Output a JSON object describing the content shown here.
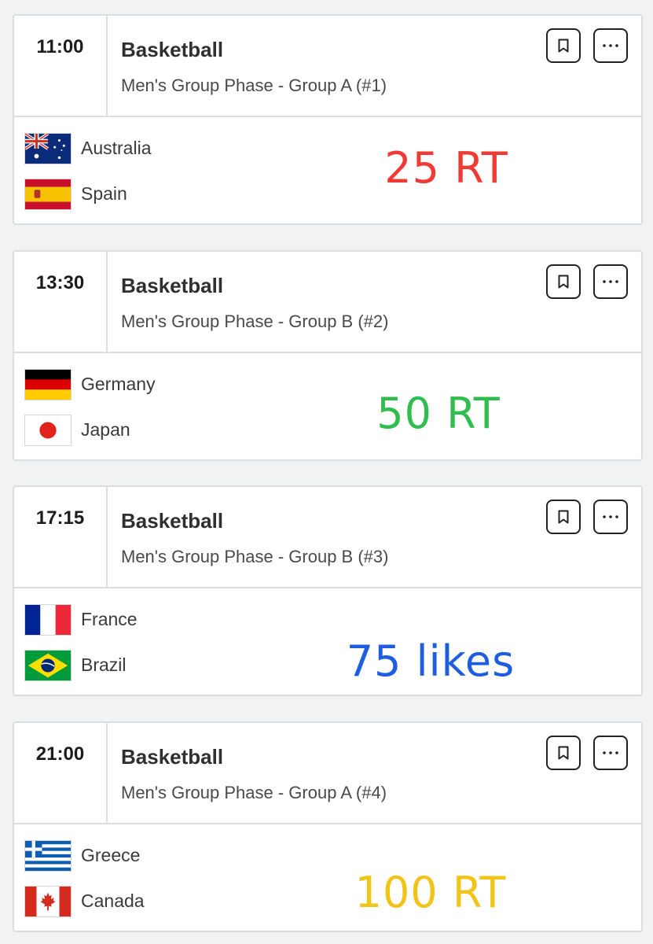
{
  "events": [
    {
      "time": "11:00",
      "sport": "Basketball",
      "phase": "Men's Group Phase - Group A (#1)",
      "team1": {
        "name": "Australia",
        "flag_icon": "australia-flag-icon"
      },
      "team2": {
        "name": "Spain",
        "flag_icon": "spain-flag-icon"
      },
      "overlay": {
        "text": "25 RT",
        "color": "#f03a33"
      }
    },
    {
      "time": "13:30",
      "sport": "Basketball",
      "phase": "Men's Group Phase - Group B (#2)",
      "team1": {
        "name": "Germany",
        "flag_icon": "germany-flag-icon"
      },
      "team2": {
        "name": "Japan",
        "flag_icon": "japan-flag-icon"
      },
      "overlay": {
        "text": "50 RT",
        "color": "#2fbd4d"
      }
    },
    {
      "time": "17:15",
      "sport": "Basketball",
      "phase": "Men's Group Phase - Group B (#3)",
      "team1": {
        "name": "France",
        "flag_icon": "france-flag-icon"
      },
      "team2": {
        "name": "Brazil",
        "flag_icon": "brazil-flag-icon"
      },
      "overlay": {
        "text": "75 likes",
        "color": "#1f5de0"
      }
    },
    {
      "time": "21:00",
      "sport": "Basketball",
      "phase": "Men's Group Phase - Group A (#4)",
      "team1": {
        "name": "Greece",
        "flag_icon": "greece-flag-icon"
      },
      "team2": {
        "name": "Canada",
        "flag_icon": "canada-flag-icon"
      },
      "overlay": {
        "text": "100 RT",
        "color": "#f2c418"
      }
    }
  ],
  "icons": {
    "bookmark": "bookmark-icon",
    "more": "more-options-icon"
  },
  "colors": {
    "border": "#dcdde1",
    "background": "#f1f2f4",
    "card": "#ffffff"
  }
}
